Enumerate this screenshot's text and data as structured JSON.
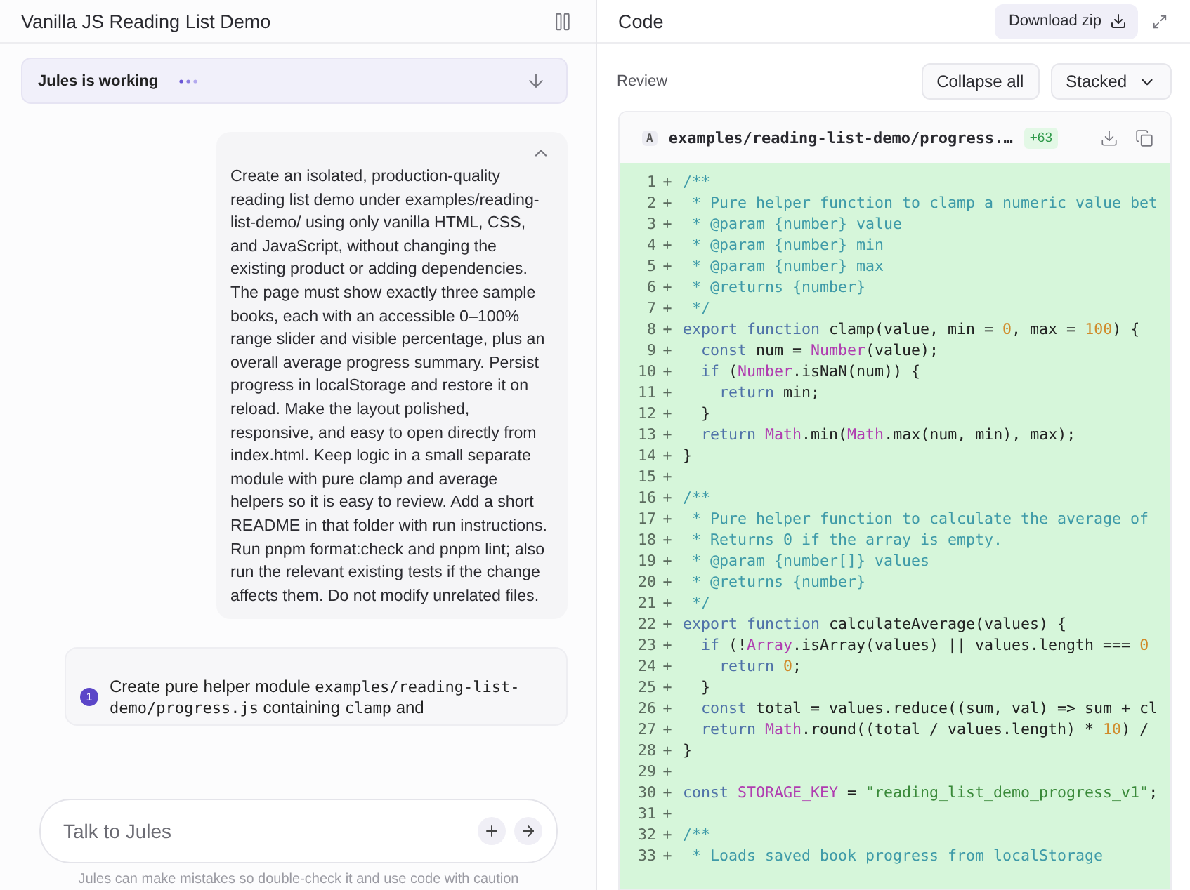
{
  "chat": {
    "title": "Vanilla JS Reading List Demo",
    "status": {
      "label": "Jules is working"
    },
    "message": {
      "expanded": true,
      "text": "Create an isolated, production-quality reading list demo under examples/reading-list-demo/ using only vanilla HTML, CSS, and JavaScript, without changing the existing product or adding dependencies. The page must show exactly three sample books, each with an accessible 0–100% range slider and visible percentage, plus an overall average progress summary. Persist progress in localStorage and restore it on reload. Make the layout polished, responsive, and easy to open directly from index.html. Keep logic in a small separate module with pure clamp and average helpers so it is easy to review. Add a short README in that folder with run instructions. Run pnpm format:check and pnpm lint; also run the relevant existing tests if the change affects them. Do not modify unrelated files."
    },
    "step": {
      "number": "1",
      "parts": [
        {
          "kind": "text",
          "text": "Create pure helper module "
        },
        {
          "kind": "code",
          "text": "examples/reading-list-demo/progress.js"
        },
        {
          "kind": "text",
          "text": " containing "
        },
        {
          "kind": "code",
          "text": "clamp"
        },
        {
          "kind": "text",
          "text": " and"
        }
      ]
    },
    "input": {
      "placeholder": "Talk to Jules"
    },
    "disclaimer": "Jules can make mistakes so double-check it and use code with caution"
  },
  "code": {
    "title": "Code",
    "download_button": "Download zip",
    "review_label": "Review",
    "collapse_button": "Collapse all",
    "view_select": "Stacked",
    "file": {
      "status": "A",
      "path": "examples/reading-list-demo/progress.…",
      "additions": "+63",
      "lines": [
        {
          "number": "1",
          "marker": "+",
          "tokens": [
            {
              "kind": "comment",
              "text": "/**"
            }
          ]
        },
        {
          "number": "2",
          "marker": "+",
          "tokens": [
            {
              "kind": "comment",
              "text": " * Pure helper function to clamp a numeric value bet"
            }
          ]
        },
        {
          "number": "3",
          "marker": "+",
          "tokens": [
            {
              "kind": "comment",
              "text": " * @param {number} value"
            }
          ]
        },
        {
          "number": "4",
          "marker": "+",
          "tokens": [
            {
              "kind": "comment",
              "text": " * @param {number} min"
            }
          ]
        },
        {
          "number": "5",
          "marker": "+",
          "tokens": [
            {
              "kind": "comment",
              "text": " * @param {number} max"
            }
          ]
        },
        {
          "number": "6",
          "marker": "+",
          "tokens": [
            {
              "kind": "comment",
              "text": " * @returns {number}"
            }
          ]
        },
        {
          "number": "7",
          "marker": "+",
          "tokens": [
            {
              "kind": "comment",
              "text": " */"
            }
          ]
        },
        {
          "number": "8",
          "marker": "+",
          "tokens": [
            {
              "kind": "keyword",
              "text": "export function "
            },
            {
              "kind": "plain",
              "text": "clamp(value, min = "
            },
            {
              "kind": "number",
              "text": "0"
            },
            {
              "kind": "plain",
              "text": ", max = "
            },
            {
              "kind": "number",
              "text": "100"
            },
            {
              "kind": "plain",
              "text": ") {"
            }
          ]
        },
        {
          "number": "9",
          "marker": "+",
          "tokens": [
            {
              "kind": "keyword",
              "text": "  const "
            },
            {
              "kind": "plain",
              "text": "num = "
            },
            {
              "kind": "builtin",
              "text": "Number"
            },
            {
              "kind": "plain",
              "text": "(value);"
            }
          ]
        },
        {
          "number": "10",
          "marker": "+",
          "tokens": [
            {
              "kind": "keyword",
              "text": "  if "
            },
            {
              "kind": "plain",
              "text": "("
            },
            {
              "kind": "builtin",
              "text": "Number"
            },
            {
              "kind": "plain",
              "text": ".isNaN(num)) {"
            }
          ]
        },
        {
          "number": "11",
          "marker": "+",
          "tokens": [
            {
              "kind": "keyword",
              "text": "    return "
            },
            {
              "kind": "plain",
              "text": "min;"
            }
          ]
        },
        {
          "number": "12",
          "marker": "+",
          "tokens": [
            {
              "kind": "plain",
              "text": "  }"
            }
          ]
        },
        {
          "number": "13",
          "marker": "+",
          "tokens": [
            {
              "kind": "keyword",
              "text": "  return "
            },
            {
              "kind": "builtin",
              "text": "Math"
            },
            {
              "kind": "plain",
              "text": ".min("
            },
            {
              "kind": "builtin",
              "text": "Math"
            },
            {
              "kind": "plain",
              "text": ".max(num, min), max);"
            }
          ]
        },
        {
          "number": "14",
          "marker": "+",
          "tokens": [
            {
              "kind": "plain",
              "text": "}"
            }
          ]
        },
        {
          "number": "15",
          "marker": "+"
        },
        {
          "number": "16",
          "marker": "+",
          "tokens": [
            {
              "kind": "comment",
              "text": "/**"
            }
          ]
        },
        {
          "number": "17",
          "marker": "+",
          "tokens": [
            {
              "kind": "comment",
              "text": " * Pure helper function to calculate the average of"
            }
          ]
        },
        {
          "number": "18",
          "marker": "+",
          "tokens": [
            {
              "kind": "comment",
              "text": " * Returns 0 if the array is empty."
            }
          ]
        },
        {
          "number": "19",
          "marker": "+",
          "tokens": [
            {
              "kind": "comment",
              "text": " * @param {number[]} values"
            }
          ]
        },
        {
          "number": "20",
          "marker": "+",
          "tokens": [
            {
              "kind": "comment",
              "text": " * @returns {number}"
            }
          ]
        },
        {
          "number": "21",
          "marker": "+",
          "tokens": [
            {
              "kind": "comment",
              "text": " */"
            }
          ]
        },
        {
          "number": "22",
          "marker": "+",
          "tokens": [
            {
              "kind": "keyword",
              "text": "export function "
            },
            {
              "kind": "plain",
              "text": "calculateAverage(values) {"
            }
          ]
        },
        {
          "number": "23",
          "marker": "+",
          "tokens": [
            {
              "kind": "keyword",
              "text": "  if "
            },
            {
              "kind": "plain",
              "text": "(!"
            },
            {
              "kind": "builtin",
              "text": "Array"
            },
            {
              "kind": "plain",
              "text": ".isArray(values) || values.length === "
            },
            {
              "kind": "number",
              "text": "0"
            }
          ]
        },
        {
          "number": "24",
          "marker": "+",
          "tokens": [
            {
              "kind": "keyword",
              "text": "    return "
            },
            {
              "kind": "number",
              "text": "0"
            },
            {
              "kind": "plain",
              "text": ";"
            }
          ]
        },
        {
          "number": "25",
          "marker": "+",
          "tokens": [
            {
              "kind": "plain",
              "text": "  }"
            }
          ]
        },
        {
          "number": "26",
          "marker": "+",
          "tokens": [
            {
              "kind": "keyword",
              "text": "  const "
            },
            {
              "kind": "plain",
              "text": "total = values.reduce((sum, val) => sum + cl"
            }
          ]
        },
        {
          "number": "27",
          "marker": "+",
          "tokens": [
            {
              "kind": "keyword",
              "text": "  return "
            },
            {
              "kind": "builtin",
              "text": "Math"
            },
            {
              "kind": "plain",
              "text": ".round((total / values.length) * "
            },
            {
              "kind": "number",
              "text": "10"
            },
            {
              "kind": "plain",
              "text": ") /"
            }
          ]
        },
        {
          "number": "28",
          "marker": "+",
          "tokens": [
            {
              "kind": "plain",
              "text": "}"
            }
          ]
        },
        {
          "number": "29",
          "marker": "+"
        },
        {
          "number": "30",
          "marker": "+",
          "tokens": [
            {
              "kind": "keyword",
              "text": "const "
            },
            {
              "kind": "builtin",
              "text": "STORAGE_KEY"
            },
            {
              "kind": "plain",
              "text": " = "
            },
            {
              "kind": "string",
              "text": "\"reading_list_demo_progress_v1\""
            },
            {
              "kind": "plain",
              "text": ";"
            }
          ]
        },
        {
          "number": "31",
          "marker": "+"
        },
        {
          "number": "32",
          "marker": "+",
          "tokens": [
            {
              "kind": "comment",
              "text": "/**"
            }
          ]
        },
        {
          "number": "33",
          "marker": "+",
          "tokens": [
            {
              "kind": "comment",
              "text": " * Loads saved book progress from localStorage"
            }
          ]
        }
      ]
    }
  }
}
